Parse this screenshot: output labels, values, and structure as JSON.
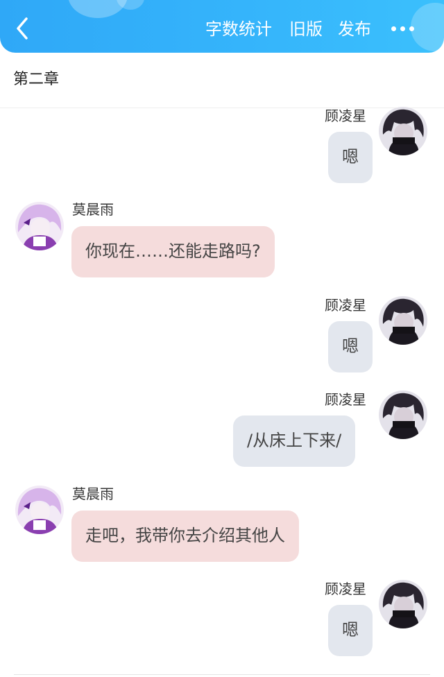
{
  "topbar": {
    "back_icon": "chevron-left-icon",
    "word_count_label": "字数统计",
    "old_version_label": "旧版",
    "publish_label": "发布",
    "more_icon": "more-dots-icon",
    "color": "#35b4fb"
  },
  "chapter": {
    "title": "第二章"
  },
  "characters": {
    "right": {
      "name": "顾凌星",
      "avatar_icon": "dark-hair-avatar"
    },
    "left": {
      "name": "莫晨雨",
      "avatar_icon": "purple-hair-avatar"
    }
  },
  "messages": [
    {
      "side": "right",
      "name": "顾凌星",
      "text": "嗯"
    },
    {
      "side": "left",
      "name": "莫晨雨",
      "text": "你现在……还能走路吗?"
    },
    {
      "side": "right",
      "name": "顾凌星",
      "text": "嗯"
    },
    {
      "side": "right",
      "name": "顾凌星",
      "text": "/从床上下来/"
    },
    {
      "side": "left",
      "name": "莫晨雨",
      "text": "走吧，我带你去介绍其他人"
    },
    {
      "side": "right",
      "name": "顾凌星",
      "text": "嗯"
    }
  ],
  "colors": {
    "right_bubble": "#e3e7ee",
    "left_bubble": "#f5dcdc"
  }
}
